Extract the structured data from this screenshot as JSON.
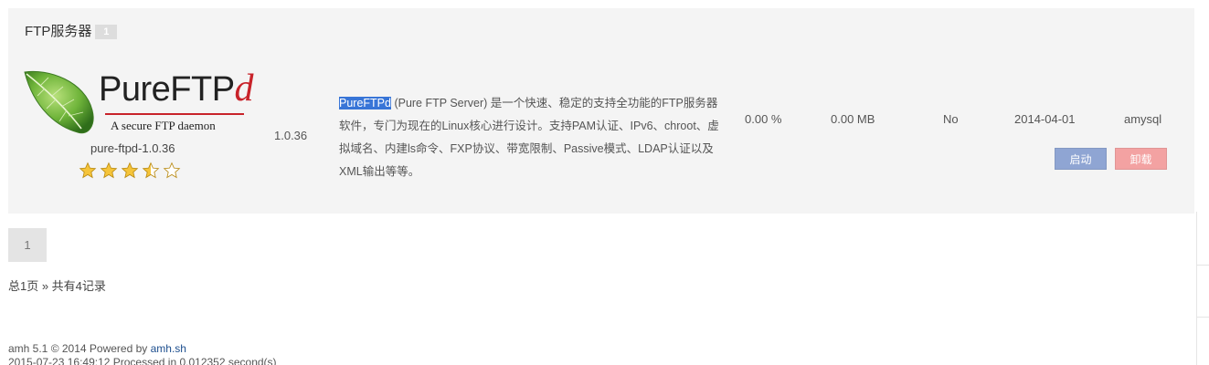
{
  "panel": {
    "title": "FTP服务器",
    "badge": "1"
  },
  "app": {
    "logo_main": "PureFTP",
    "logo_d": "d",
    "logo_tagline": "A secure FTP daemon",
    "package": "pure-ftpd-1.0.36",
    "rating": 3.5,
    "version": "1.0.36",
    "description_highlight": "PureFTPd",
    "description_rest": " (Pure FTP Server) 是一个快速、稳定的支持全功能的FTP服务器软件，专门为现在的Linux核心进行设计。支持PAM认证、IPv6、chroot、虚拟域名、内建ls命令、FXP协议、带宽限制、Passive模式、LDAP认证以及XML输出等等。",
    "cpu": "0.00 %",
    "memory": "0.00 MB",
    "running": "No",
    "date": "2014-04-01",
    "dependency": "amysql",
    "start_label": "启动",
    "uninstall_label": "卸载"
  },
  "pagination": {
    "current_page": "1",
    "summary": "总1页 » 共有4记录"
  },
  "footer": {
    "prefix": "amh 5.1 © 2014 Powered by ",
    "link": "amh.sh",
    "line2": "2015-07-23 16:49:12 Processed in 0.012352 second(s)"
  },
  "colors": {
    "panel_bg": "#f4f4f4",
    "start_button": "#8fa5d3",
    "uninstall_button": "#f3a2a2",
    "logo_accent": "#c8232a",
    "highlight": "#3875d7"
  }
}
